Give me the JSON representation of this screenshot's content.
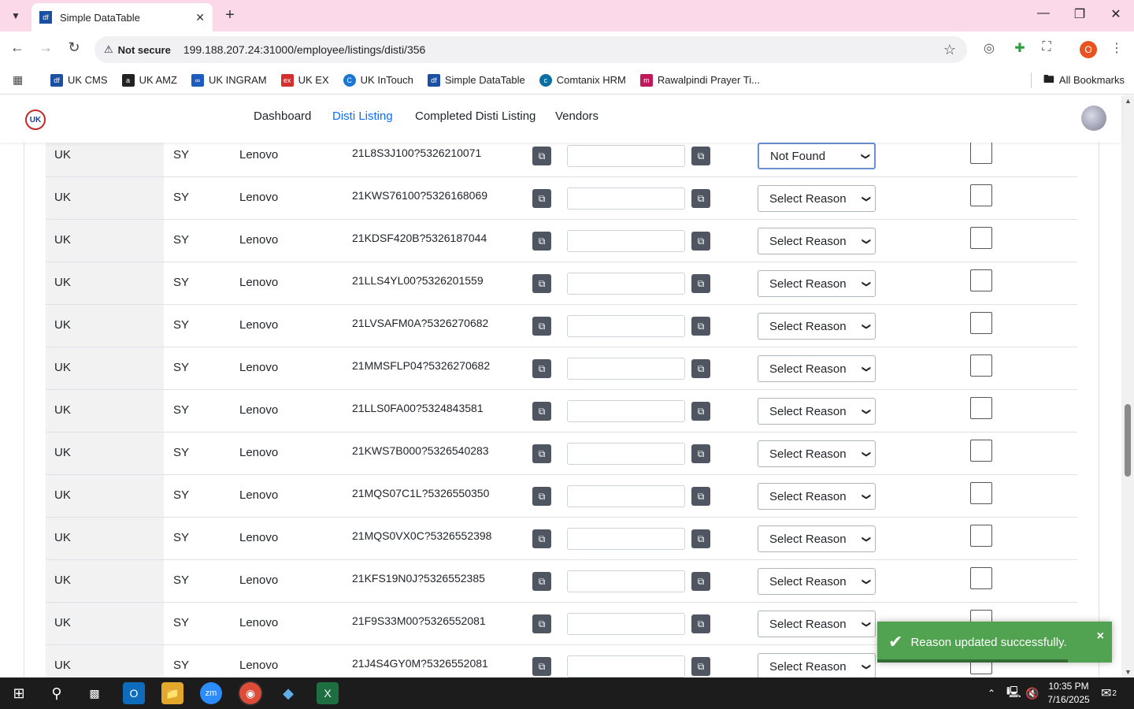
{
  "browser": {
    "tab_title": "Simple DataTable",
    "tab_favicon": "df",
    "security": "Not secure",
    "url": "199.188.207.24:31000/employee/listings/disti/356",
    "profile_initial": "O",
    "bookmarks": [
      {
        "label": "UK CMS",
        "icon": "df",
        "color": "#1b4fa3"
      },
      {
        "label": "UK AMZ",
        "icon": "a",
        "color": "#222222"
      },
      {
        "label": "UK INGRAM",
        "icon": "ingram",
        "color": "#1e5bbf"
      },
      {
        "label": "UK EX",
        "icon": "ex",
        "color": "#d32f2f"
      },
      {
        "label": "UK InTouch",
        "icon": "C",
        "color": "#1976d2"
      },
      {
        "label": "Simple DataTable",
        "icon": "df",
        "color": "#1b4fa3"
      },
      {
        "label": "Comtanix HRM",
        "icon": "c",
        "color": "#0b6fa4"
      },
      {
        "label": "Rawalpindi Prayer Ti...",
        "icon": "m",
        "color": "#c2185b"
      }
    ],
    "all_bookmarks": "All Bookmarks"
  },
  "app": {
    "logo": "UK",
    "nav": [
      "Dashboard",
      "Disti Listing",
      "Completed Disti Listing",
      "Vendors"
    ],
    "active_nav": "Disti Listing"
  },
  "rows": [
    {
      "country": "UK",
      "code": "SY",
      "brand": "Lenovo",
      "sku": "21L8S3J100?5326210071",
      "reason": "Not Found"
    },
    {
      "country": "UK",
      "code": "SY",
      "brand": "Lenovo",
      "sku": "21KWS76100?5326168069",
      "reason": "Select Reason"
    },
    {
      "country": "UK",
      "code": "SY",
      "brand": "Lenovo",
      "sku": "21KDSF420B?5326187044",
      "reason": "Select Reason"
    },
    {
      "country": "UK",
      "code": "SY",
      "brand": "Lenovo",
      "sku": "21LLS4YL00?5326201559",
      "reason": "Select Reason"
    },
    {
      "country": "UK",
      "code": "SY",
      "brand": "Lenovo",
      "sku": "21LVSAFM0A?5326270682",
      "reason": "Select Reason"
    },
    {
      "country": "UK",
      "code": "SY",
      "brand": "Lenovo",
      "sku": "21MMSFLP04?5326270682",
      "reason": "Select Reason"
    },
    {
      "country": "UK",
      "code": "SY",
      "brand": "Lenovo",
      "sku": "21LLS0FA00?5324843581",
      "reason": "Select Reason"
    },
    {
      "country": "UK",
      "code": "SY",
      "brand": "Lenovo",
      "sku": "21KWS7B000?5326540283",
      "reason": "Select Reason"
    },
    {
      "country": "UK",
      "code": "SY",
      "brand": "Lenovo",
      "sku": "21MQS07C1L?5326550350",
      "reason": "Select Reason"
    },
    {
      "country": "UK",
      "code": "SY",
      "brand": "Lenovo",
      "sku": "21MQS0VX0C?5326552398",
      "reason": "Select Reason"
    },
    {
      "country": "UK",
      "code": "SY",
      "brand": "Lenovo",
      "sku": "21KFS19N0J?5326552385",
      "reason": "Select Reason"
    },
    {
      "country": "UK",
      "code": "SY",
      "brand": "Lenovo",
      "sku": "21F9S33M00?5326552081",
      "reason": "Select Reason"
    },
    {
      "country": "UK",
      "code": "SY",
      "brand": "Lenovo",
      "sku": "21J4S4GY0M?5326552081",
      "reason": "Select Reason"
    }
  ],
  "toast": {
    "message": "Reason updated successfully.",
    "close": "×"
  },
  "taskbar": {
    "time": "10:35 PM",
    "date": "7/16/2025",
    "notifications": "2"
  }
}
